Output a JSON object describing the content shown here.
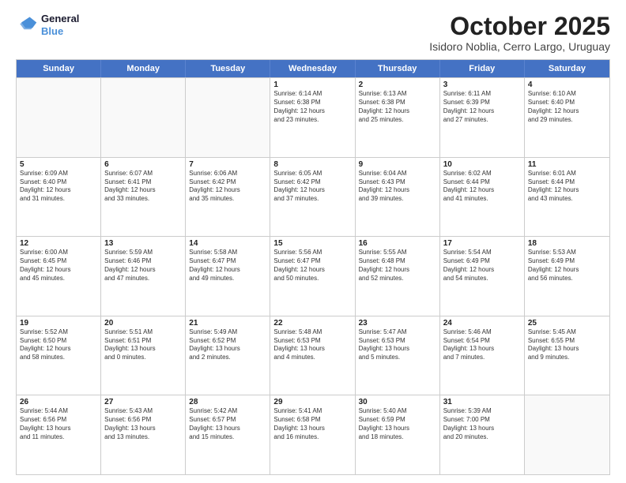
{
  "logo": {
    "line1": "General",
    "line2": "Blue"
  },
  "title": "October 2025",
  "subtitle": "Isidoro Noblia, Cerro Largo, Uruguay",
  "days": [
    "Sunday",
    "Monday",
    "Tuesday",
    "Wednesday",
    "Thursday",
    "Friday",
    "Saturday"
  ],
  "weeks": [
    [
      {
        "num": "",
        "text": ""
      },
      {
        "num": "",
        "text": ""
      },
      {
        "num": "",
        "text": ""
      },
      {
        "num": "1",
        "text": "Sunrise: 6:14 AM\nSunset: 6:38 PM\nDaylight: 12 hours\nand 23 minutes."
      },
      {
        "num": "2",
        "text": "Sunrise: 6:13 AM\nSunset: 6:38 PM\nDaylight: 12 hours\nand 25 minutes."
      },
      {
        "num": "3",
        "text": "Sunrise: 6:11 AM\nSunset: 6:39 PM\nDaylight: 12 hours\nand 27 minutes."
      },
      {
        "num": "4",
        "text": "Sunrise: 6:10 AM\nSunset: 6:40 PM\nDaylight: 12 hours\nand 29 minutes."
      }
    ],
    [
      {
        "num": "5",
        "text": "Sunrise: 6:09 AM\nSunset: 6:40 PM\nDaylight: 12 hours\nand 31 minutes."
      },
      {
        "num": "6",
        "text": "Sunrise: 6:07 AM\nSunset: 6:41 PM\nDaylight: 12 hours\nand 33 minutes."
      },
      {
        "num": "7",
        "text": "Sunrise: 6:06 AM\nSunset: 6:42 PM\nDaylight: 12 hours\nand 35 minutes."
      },
      {
        "num": "8",
        "text": "Sunrise: 6:05 AM\nSunset: 6:42 PM\nDaylight: 12 hours\nand 37 minutes."
      },
      {
        "num": "9",
        "text": "Sunrise: 6:04 AM\nSunset: 6:43 PM\nDaylight: 12 hours\nand 39 minutes."
      },
      {
        "num": "10",
        "text": "Sunrise: 6:02 AM\nSunset: 6:44 PM\nDaylight: 12 hours\nand 41 minutes."
      },
      {
        "num": "11",
        "text": "Sunrise: 6:01 AM\nSunset: 6:44 PM\nDaylight: 12 hours\nand 43 minutes."
      }
    ],
    [
      {
        "num": "12",
        "text": "Sunrise: 6:00 AM\nSunset: 6:45 PM\nDaylight: 12 hours\nand 45 minutes."
      },
      {
        "num": "13",
        "text": "Sunrise: 5:59 AM\nSunset: 6:46 PM\nDaylight: 12 hours\nand 47 minutes."
      },
      {
        "num": "14",
        "text": "Sunrise: 5:58 AM\nSunset: 6:47 PM\nDaylight: 12 hours\nand 49 minutes."
      },
      {
        "num": "15",
        "text": "Sunrise: 5:56 AM\nSunset: 6:47 PM\nDaylight: 12 hours\nand 50 minutes."
      },
      {
        "num": "16",
        "text": "Sunrise: 5:55 AM\nSunset: 6:48 PM\nDaylight: 12 hours\nand 52 minutes."
      },
      {
        "num": "17",
        "text": "Sunrise: 5:54 AM\nSunset: 6:49 PM\nDaylight: 12 hours\nand 54 minutes."
      },
      {
        "num": "18",
        "text": "Sunrise: 5:53 AM\nSunset: 6:49 PM\nDaylight: 12 hours\nand 56 minutes."
      }
    ],
    [
      {
        "num": "19",
        "text": "Sunrise: 5:52 AM\nSunset: 6:50 PM\nDaylight: 12 hours\nand 58 minutes."
      },
      {
        "num": "20",
        "text": "Sunrise: 5:51 AM\nSunset: 6:51 PM\nDaylight: 13 hours\nand 0 minutes."
      },
      {
        "num": "21",
        "text": "Sunrise: 5:49 AM\nSunset: 6:52 PM\nDaylight: 13 hours\nand 2 minutes."
      },
      {
        "num": "22",
        "text": "Sunrise: 5:48 AM\nSunset: 6:53 PM\nDaylight: 13 hours\nand 4 minutes."
      },
      {
        "num": "23",
        "text": "Sunrise: 5:47 AM\nSunset: 6:53 PM\nDaylight: 13 hours\nand 5 minutes."
      },
      {
        "num": "24",
        "text": "Sunrise: 5:46 AM\nSunset: 6:54 PM\nDaylight: 13 hours\nand 7 minutes."
      },
      {
        "num": "25",
        "text": "Sunrise: 5:45 AM\nSunset: 6:55 PM\nDaylight: 13 hours\nand 9 minutes."
      }
    ],
    [
      {
        "num": "26",
        "text": "Sunrise: 5:44 AM\nSunset: 6:56 PM\nDaylight: 13 hours\nand 11 minutes."
      },
      {
        "num": "27",
        "text": "Sunrise: 5:43 AM\nSunset: 6:56 PM\nDaylight: 13 hours\nand 13 minutes."
      },
      {
        "num": "28",
        "text": "Sunrise: 5:42 AM\nSunset: 6:57 PM\nDaylight: 13 hours\nand 15 minutes."
      },
      {
        "num": "29",
        "text": "Sunrise: 5:41 AM\nSunset: 6:58 PM\nDaylight: 13 hours\nand 16 minutes."
      },
      {
        "num": "30",
        "text": "Sunrise: 5:40 AM\nSunset: 6:59 PM\nDaylight: 13 hours\nand 18 minutes."
      },
      {
        "num": "31",
        "text": "Sunrise: 5:39 AM\nSunset: 7:00 PM\nDaylight: 13 hours\nand 20 minutes."
      },
      {
        "num": "",
        "text": ""
      }
    ]
  ]
}
